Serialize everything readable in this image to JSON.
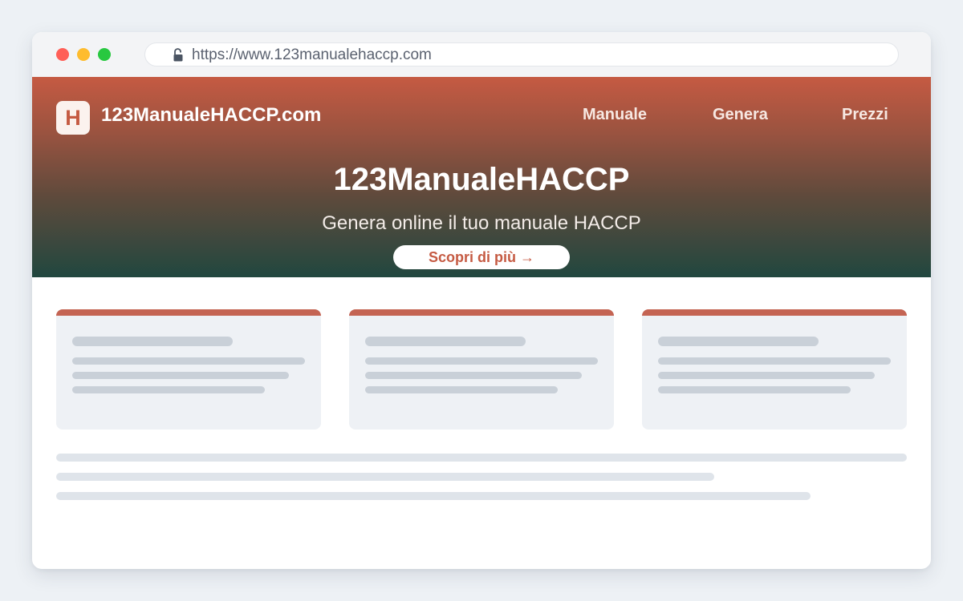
{
  "browser": {
    "url": "https://www.123manualehaccp.com",
    "lock_icon": "lock-icon",
    "window_controls": {
      "close_color": "#ff5f57",
      "minimize_color": "#febc2e",
      "maximize_color": "#28c840"
    }
  },
  "site": {
    "logo_letter": "H",
    "brand": "123ManualeHACCP.com",
    "nav": [
      {
        "label": "Manuale"
      },
      {
        "label": "Genera"
      },
      {
        "label": "Prezzi"
      }
    ]
  },
  "hero": {
    "title": "123ManualeHACCP",
    "subtitle": "Genera online il tuo manuale HACCP",
    "cta_label": "Scopri di più →"
  },
  "colors": {
    "accent": "#c55a42",
    "gradient_end": "#21473f",
    "card_accent": "#c46453",
    "placeholder": "#c9d0d8"
  }
}
